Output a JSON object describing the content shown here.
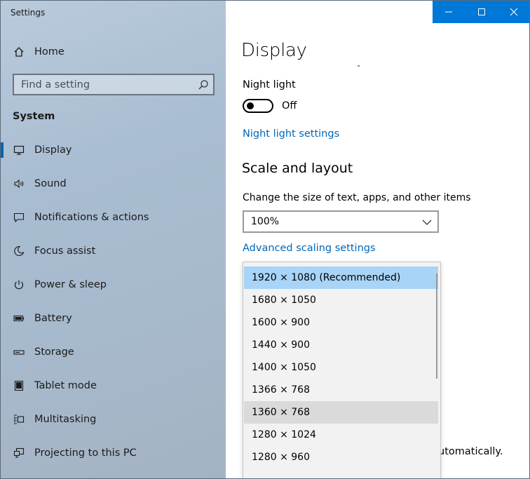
{
  "window": {
    "title": "Settings"
  },
  "title_controls": {
    "minimize": "—",
    "maximize": "☐",
    "close": "✕"
  },
  "sidebar": {
    "home": "Home",
    "search_placeholder": "Find a setting",
    "section": "System",
    "items": [
      {
        "label": "Display",
        "icon": "monitor-icon",
        "selected": true
      },
      {
        "label": "Sound",
        "icon": "speaker-icon"
      },
      {
        "label": "Notifications & actions",
        "icon": "notification-icon"
      },
      {
        "label": "Focus assist",
        "icon": "moon-icon"
      },
      {
        "label": "Power & sleep",
        "icon": "power-icon"
      },
      {
        "label": "Battery",
        "icon": "battery-icon"
      },
      {
        "label": "Storage",
        "icon": "storage-icon"
      },
      {
        "label": "Tablet mode",
        "icon": "tablet-icon"
      },
      {
        "label": "Multitasking",
        "icon": "multitasking-icon"
      },
      {
        "label": "Projecting to this PC",
        "icon": "projecting-icon"
      }
    ]
  },
  "main": {
    "title": "Display",
    "night_light_label": "Night light",
    "night_light_state": "Off",
    "night_light_settings_link": "Night light settings",
    "scale_heading": "Scale and layout",
    "scale_label": "Change the size of text, apps, and other items",
    "scale_value": "100%",
    "advanced_scaling_link": "Advanced scaling settings",
    "bottom_partial_text": "utomatically."
  },
  "resolution_dropdown": {
    "selected": "1920 × 1080 (Recommended)",
    "hovered": "1360 × 768",
    "options": [
      "1920 × 1080 (Recommended)",
      "1680 × 1050",
      "1600 × 900",
      "1440 × 900",
      "1400 × 1050",
      "1366 × 768",
      "1360 × 768",
      "1280 × 1024",
      "1280 × 960"
    ]
  },
  "colors": {
    "accent": "#0078d7",
    "link": "#0067b8",
    "selected_option": "#a8d4f7"
  }
}
